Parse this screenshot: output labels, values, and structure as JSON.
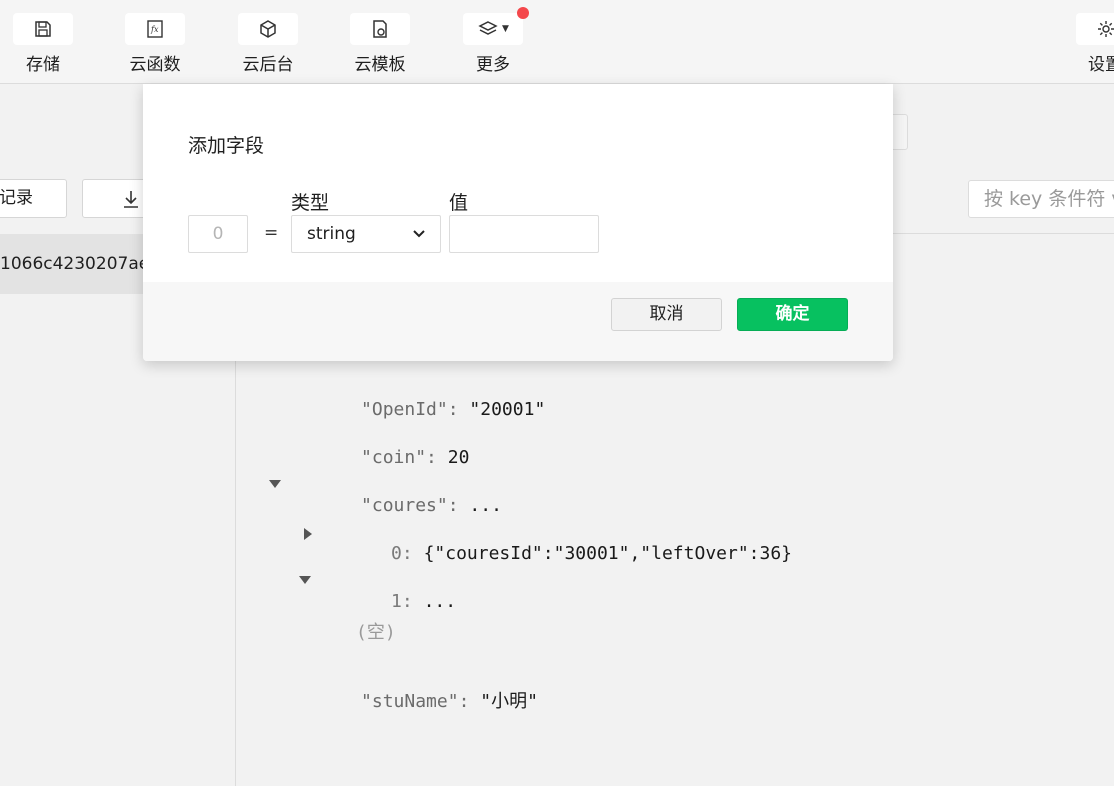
{
  "toolbar": {
    "items": [
      {
        "label": "存储",
        "icon": "save-icon"
      },
      {
        "label": "云函数",
        "icon": "function-icon"
      },
      {
        "label": "云后台",
        "icon": "cube-icon"
      },
      {
        "label": "云模板",
        "icon": "template-icon"
      },
      {
        "label": "更多",
        "icon": "layers-icon"
      },
      {
        "label": "设置",
        "icon": "gear-icon"
      }
    ],
    "notification_color": "#f4474b"
  },
  "left_panel": {
    "record_button": "记录",
    "selected_record": "1066c4230207ae"
  },
  "filter": {
    "placeholder": "按 key 条件符 v"
  },
  "record": {
    "fields": [
      {
        "key": "\"OpenId\":",
        "value": "\"20001\""
      },
      {
        "key": "\"coin\":",
        "value": "20"
      },
      {
        "key": "\"coures\":",
        "value": "..."
      },
      {
        "key": "0:",
        "value": "{\"couresId\":\"30001\",\"leftOver\":36}"
      },
      {
        "key": "1:",
        "value": "..."
      },
      {
        "key": "",
        "value": "(空)"
      },
      {
        "key": "\"stuName\":",
        "value": "\"小明\""
      }
    ]
  },
  "dialog": {
    "title": "添加字段",
    "type_label": "类型",
    "value_label": "值",
    "key_placeholder": "0",
    "equals": "=",
    "type_value": "string",
    "cancel": "取消",
    "confirm": "确定",
    "accent_color": "#07c160"
  }
}
